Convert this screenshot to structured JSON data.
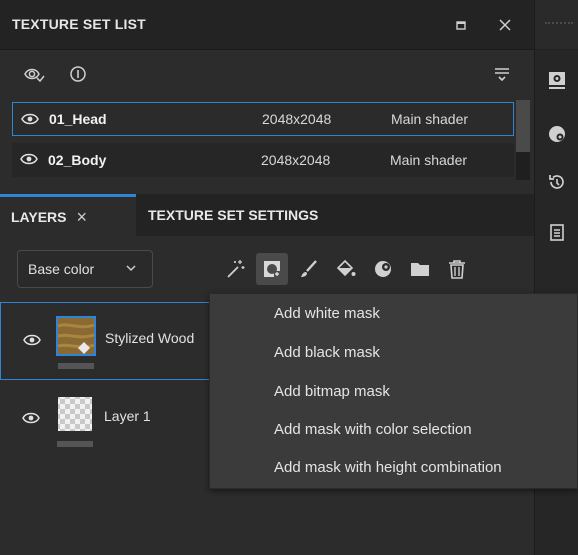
{
  "texture_set_panel": {
    "title": "TEXTURE SET LIST",
    "rows": [
      {
        "name": "01_Head",
        "resolution": "2048x2048",
        "shader": "Main shader"
      },
      {
        "name": "02_Body",
        "resolution": "2048x2048",
        "shader": "Main shader"
      }
    ]
  },
  "tabs": {
    "layers": "LAYERS",
    "layers_close": "×",
    "texture_set_settings": "TEXTURE SET SETTINGS"
  },
  "channel": {
    "selected": "Base color"
  },
  "layers": [
    {
      "name": "Stylized Wood"
    },
    {
      "name": "Layer 1"
    }
  ],
  "mask_menu": {
    "items": [
      "Add white mask",
      "Add black mask",
      "Add bitmap mask",
      "Add mask with color selection",
      "Add mask with height combination"
    ]
  },
  "colors": {
    "accent": "#2f84d6",
    "panel_bg": "#2c2c2c",
    "header_bg": "#232323",
    "menu_bg": "#3b3b3b"
  },
  "icons": {
    "header": [
      "restore-icon",
      "close-icon"
    ],
    "toolbar": [
      "visibility-filter-icon",
      "info-icon",
      "list-menu-icon"
    ],
    "layer_tools": [
      "magic-wand-icon",
      "add-mask-icon",
      "brush-icon",
      "fill-icon",
      "smart-material-icon",
      "folder-icon",
      "trash-icon"
    ],
    "right_bar": [
      "display-settings-icon",
      "shader-icon",
      "history-icon",
      "clipboard-icon"
    ]
  }
}
